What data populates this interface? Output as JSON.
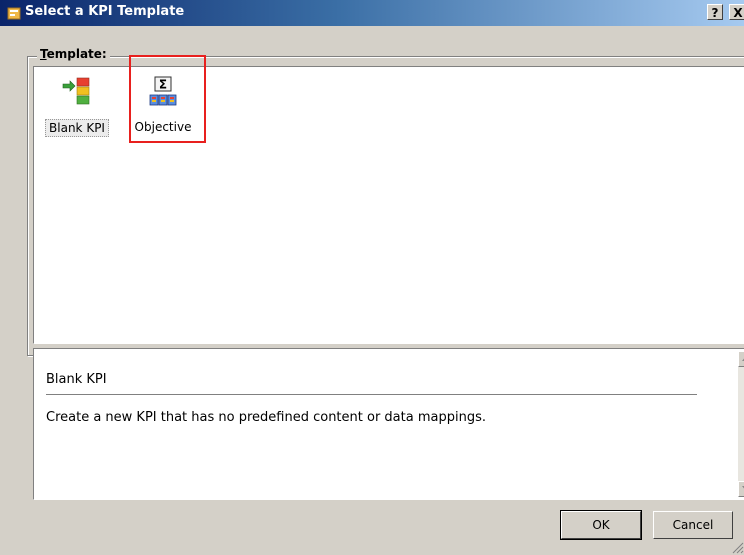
{
  "window": {
    "title": "Select a KPI Template",
    "help_button": "?",
    "close_button": "X"
  },
  "template_group": {
    "label_underlined": "T",
    "label_rest": "emplate:",
    "items": [
      {
        "label": "Blank KPI",
        "icon": "blank-kpi-icon",
        "selected": true
      },
      {
        "label": "Objective",
        "icon": "objective-icon",
        "selected": false
      }
    ]
  },
  "description": {
    "title": "Blank KPI",
    "text": "Create a new KPI that has no predefined content or data mappings."
  },
  "buttons": {
    "ok": "OK",
    "cancel": "Cancel"
  },
  "colors": {
    "dialog_face": "#d4d0c8",
    "title_gradient_start": "#0a246a",
    "title_gradient_end": "#a6caf0",
    "highlight_box": "#e8201e"
  }
}
